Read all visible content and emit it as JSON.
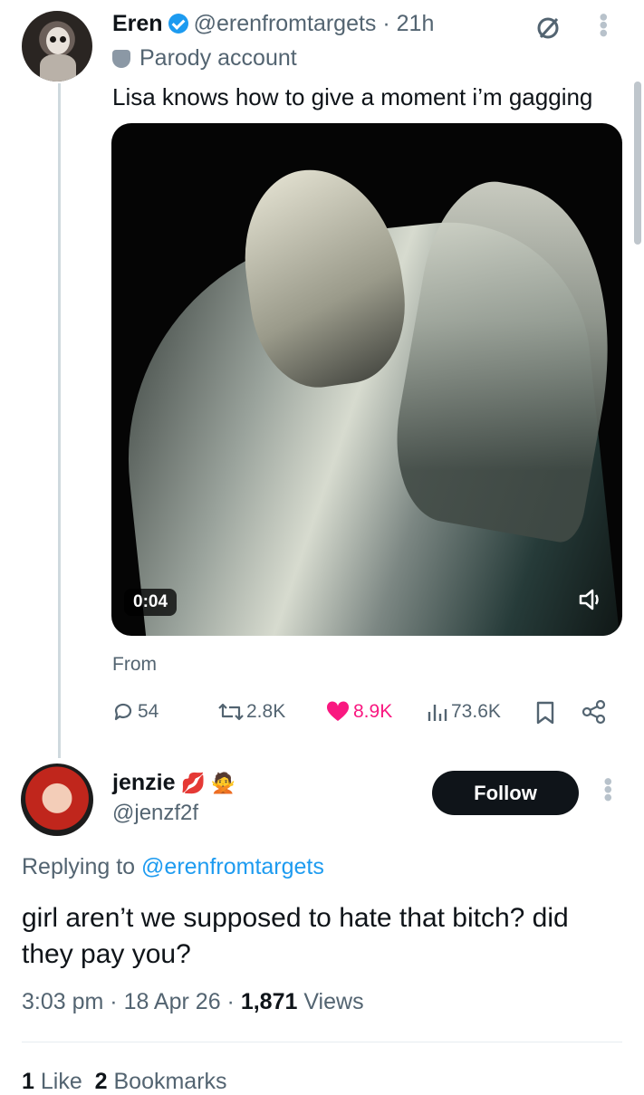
{
  "tweet": {
    "author_name": "Eren",
    "handle": "@erenfromtargets",
    "time": "21h",
    "parody_label": "Parody account",
    "text": "Lisa knows how to give a moment i’m gagging",
    "video_timer": "0:04",
    "from_label": "From",
    "stats": {
      "replies": "54",
      "reposts": "2.8K",
      "likes": "8.9K",
      "views": "73.6K"
    }
  },
  "reply": {
    "author_name": "jenzie",
    "handle": "@jenzf2f",
    "follow_label": "Follow",
    "replying_prefix": "Replying to",
    "replying_to": "@erenfromtargets",
    "text": "girl aren’t we supposed to hate that bitch? did they pay you?",
    "time": "3:03 pm",
    "date": "18 Apr 26",
    "views_count": "1,871",
    "views_label": "Views",
    "likes_count": "1",
    "likes_label": "Like",
    "bookmarks_count": "2",
    "bookmarks_label": "Bookmarks"
  },
  "colors": {
    "accent": "#1d9bf0",
    "like": "#f91880",
    "text": "#0f1419",
    "muted": "#536471"
  }
}
